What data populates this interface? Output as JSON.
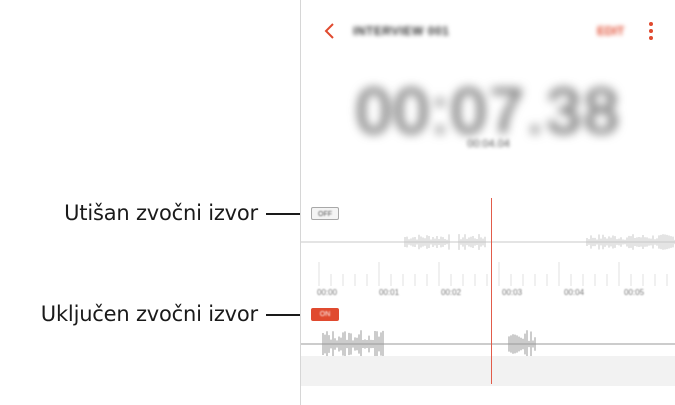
{
  "annotations": {
    "muted": "Utišan zvočni izvor",
    "active": "Uključen zvočni izvor"
  },
  "appbar": {
    "title": "INTERVIEW 001",
    "edit_label": "EDIT",
    "back_icon": "chevron-left-icon",
    "more_icon": "more-vertical-icon"
  },
  "recording": {
    "elapsed": "00:07.38",
    "total": "00:04.04"
  },
  "tracks": {
    "off_badge": "OFF",
    "on_badge": "ON"
  },
  "timeline": {
    "labels": [
      "00:00",
      "00:01",
      "00:02",
      "00:03",
      "00:04",
      "00:05"
    ]
  },
  "colors": {
    "accent": "#e04a2f",
    "playhead": "#e25c4a",
    "waveform_muted": "#c8c8c8",
    "waveform_active": "#9a9a9a"
  }
}
